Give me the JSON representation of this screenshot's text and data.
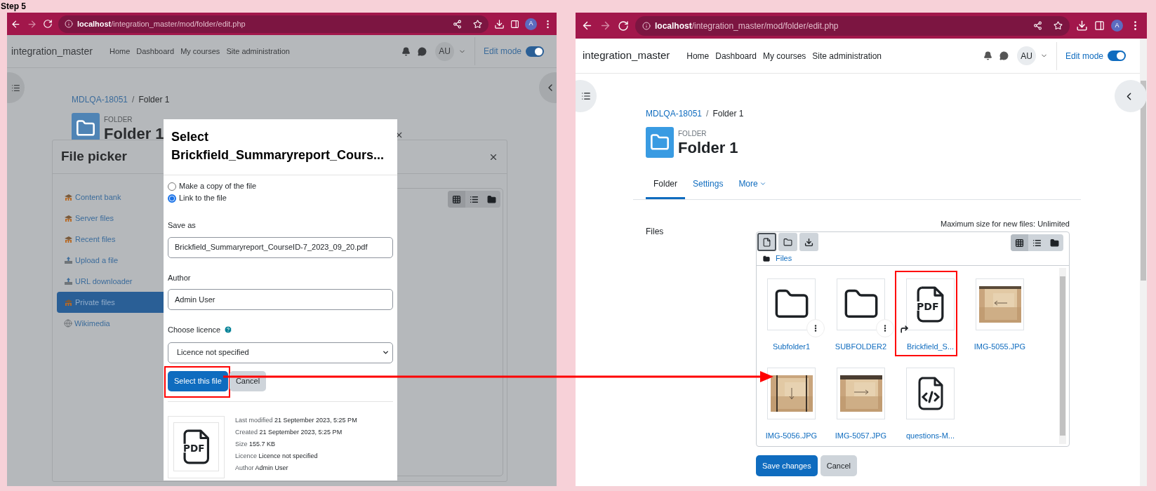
{
  "step_label": "Step 5",
  "left_screen": {
    "browser": {
      "host": "localhost",
      "path": "/integration_master/mod/folder/edit.php",
      "profile_initial": "A"
    },
    "navbar": {
      "site_name": "integration_master",
      "links": [
        "Home",
        "Dashboard",
        "My courses",
        "Site administration"
      ],
      "user_initials": "AU",
      "edit_mode_label": "Edit mode",
      "edit_mode_on": true
    },
    "breadcrumb": {
      "separator": "/",
      "items": [
        {
          "label": "MDLQA-18051",
          "kind": "link"
        },
        {
          "label": "Folder 1",
          "kind": "current"
        }
      ]
    },
    "activity": {
      "type_label": "FOLDER",
      "title": "Folder 1"
    },
    "file_picker": {
      "title": "File picker",
      "repositories": [
        {
          "label": "Content bank",
          "kind": "moodle",
          "selected": false
        },
        {
          "label": "Server files",
          "kind": "moodle",
          "selected": false
        },
        {
          "label": "Recent files",
          "kind": "moodle",
          "selected": false
        },
        {
          "label": "Upload a file",
          "kind": "upload",
          "selected": false
        },
        {
          "label": "URL downloader",
          "kind": "upload",
          "selected": false
        },
        {
          "label": "Private files",
          "kind": "moodle",
          "selected": true
        },
        {
          "label": "Wikimedia",
          "kind": "globe",
          "selected": false
        }
      ],
      "view_modes": [
        {
          "kind": "grid",
          "selected": true
        },
        {
          "kind": "list",
          "selected": false
        },
        {
          "kind": "tree",
          "selected": false
        }
      ]
    },
    "select_dialog": {
      "title": "Select Brickfield_Summaryreport_Cours...",
      "options": [
        {
          "label": "Make a copy of the file",
          "selected": false
        },
        {
          "label": "Link to the file",
          "selected": true
        }
      ],
      "save_as_label": "Save as",
      "save_as_value": "Brickfield_Summaryreport_CourseID-7_2023_09_20.pdf",
      "author_label": "Author",
      "author_value": "Admin User",
      "licence_label": "Choose licence",
      "licence_value": "Licence not specified",
      "buttons": [
        {
          "label": "Select this file",
          "kind": "primary",
          "highlighted": true
        },
        {
          "label": "Cancel",
          "kind": "secondary",
          "highlighted": false
        }
      ],
      "preview_text": "PDF",
      "details": [
        {
          "label": "Last modified",
          "value": "21 September 2023, 5:25 PM"
        },
        {
          "label": "Created",
          "value": "21 September 2023, 5:25 PM"
        },
        {
          "label": "Size",
          "value": "155.7 KB"
        },
        {
          "label": "Licence",
          "value": "Licence not specified"
        },
        {
          "label": "Author",
          "value": "Admin User"
        }
      ]
    }
  },
  "right_screen": {
    "browser": {
      "host": "localhost",
      "path": "/integration_master/mod/folder/edit.php",
      "profile_initial": "A"
    },
    "navbar": {
      "site_name": "integration_master",
      "links": [
        "Home",
        "Dashboard",
        "My courses",
        "Site administration"
      ],
      "user_initials": "AU",
      "edit_mode_label": "Edit mode",
      "edit_mode_on": true
    },
    "breadcrumb": {
      "separator": "/",
      "items": [
        {
          "label": "MDLQA-18051",
          "kind": "link"
        },
        {
          "label": "Folder 1",
          "kind": "current"
        }
      ]
    },
    "activity": {
      "type_label": "FOLDER",
      "title": "Folder 1"
    },
    "tabs": [
      {
        "label": "Folder",
        "selected": true,
        "kind": "tab"
      },
      {
        "label": "Settings",
        "selected": false,
        "kind": "tab"
      },
      {
        "label": "More",
        "selected": false,
        "kind": "dropdown"
      }
    ],
    "files_label": "Files",
    "max_size": "Maximum size for new files: Unlimited",
    "toolbar": [
      {
        "kind": "add-file",
        "focused": true
      },
      {
        "kind": "create-folder",
        "focused": false
      },
      {
        "kind": "download",
        "focused": false
      }
    ],
    "view_modes": [
      {
        "kind": "grid",
        "selected": true
      },
      {
        "kind": "list",
        "selected": false
      },
      {
        "kind": "tree",
        "selected": false
      }
    ],
    "path": "Files",
    "files": [
      {
        "name": "Subfolder1",
        "kind": "folder",
        "alias": false,
        "highlighted": false
      },
      {
        "name": "SUBFOLDER2",
        "kind": "folder",
        "alias": false,
        "highlighted": false
      },
      {
        "name": "Brickfield_S...",
        "kind": "pdf",
        "icon_text": "PDF",
        "alias": true,
        "highlighted": true
      },
      {
        "name": "IMG-5055.JPG",
        "kind": "picture",
        "alias": false,
        "highlighted": false
      },
      {
        "name": "IMG-5056.JPG",
        "kind": "picture",
        "alias": false,
        "highlighted": false
      },
      {
        "name": "IMG-5057.JPG",
        "kind": "picture",
        "alias": false,
        "highlighted": false
      },
      {
        "name": "questions-M...",
        "kind": "code",
        "alias": false,
        "highlighted": false
      }
    ],
    "buttons": [
      {
        "label": "Save changes",
        "kind": "primary"
      },
      {
        "label": "Cancel",
        "kind": "secondary"
      }
    ]
  }
}
